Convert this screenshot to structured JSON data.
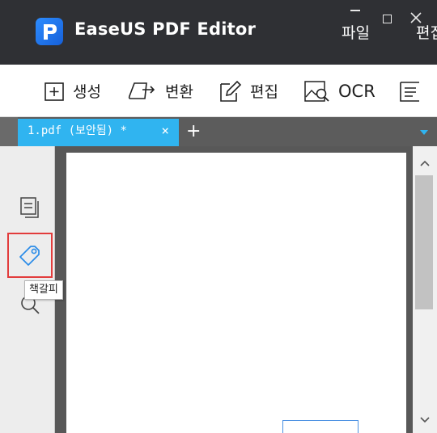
{
  "window": {
    "app_title": "EaseUS PDF Editor",
    "menu": [
      "파일",
      "편집"
    ],
    "controls": [
      "minimize",
      "maximize",
      "close"
    ]
  },
  "toolbar": {
    "items": [
      {
        "label": "생성",
        "icon": "plus-box-icon"
      },
      {
        "label": "변환",
        "icon": "convert-icon"
      },
      {
        "label": "편집",
        "icon": "edit-pencil-icon"
      },
      {
        "label": "OCR",
        "icon": "ocr-icon"
      },
      {
        "label": "",
        "icon": "page-icon"
      }
    ]
  },
  "tabs": [
    {
      "label": "1.pdf (보안됨) *",
      "active": true
    }
  ],
  "tab_add": "+",
  "tab_close": "×",
  "sidebar": {
    "items": [
      {
        "name": "pages",
        "icon": "pages-thumbnail-icon"
      },
      {
        "name": "bookmark",
        "icon": "bookmark-tag-icon",
        "active": true
      },
      {
        "name": "search",
        "icon": "search-icon"
      }
    ],
    "tooltip": "책갈피"
  },
  "colors": {
    "accent": "#30b4f0",
    "titlebar": "#2f3034",
    "highlight_border": "#e23c3c",
    "logo": "#1e72f0"
  }
}
